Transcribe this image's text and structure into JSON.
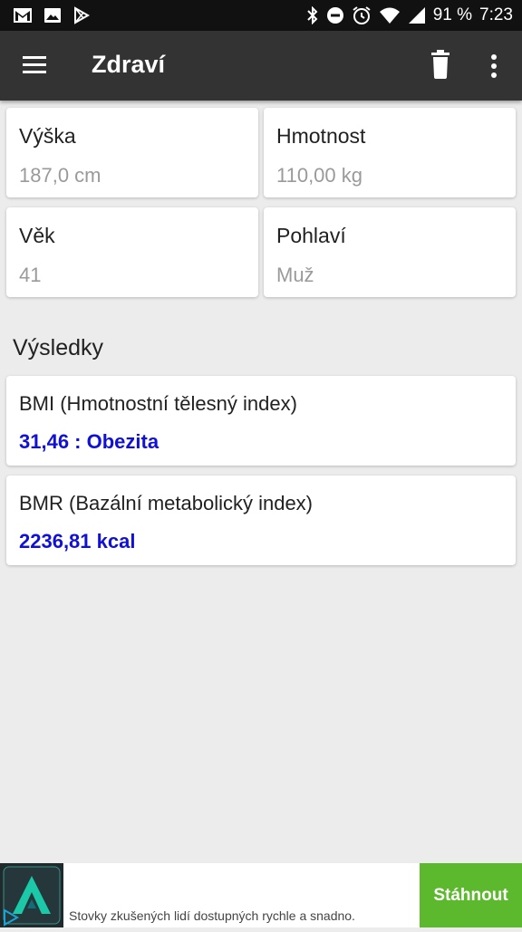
{
  "status_bar": {
    "battery": "91 %",
    "time": "7:23"
  },
  "app_bar": {
    "title": "Zdraví"
  },
  "inputs": [
    {
      "label": "Výška",
      "value": "187,0 cm"
    },
    {
      "label": "Hmotnost",
      "value": "110,00 kg"
    },
    {
      "label": "Věk",
      "value": "41"
    },
    {
      "label": "Pohlaví",
      "value": "Muž"
    }
  ],
  "results": {
    "header": "Výsledky",
    "items": [
      {
        "title": "BMI (Hmotnostní tělesný index)",
        "value": "31,46 : Obezita"
      },
      {
        "title": "BMR (Bazální metabolický index)",
        "value": "2236,81 kcal"
      }
    ]
  },
  "ad": {
    "text": "Stovky zkušených lidí dostupných rychle a snadno.",
    "button_label": "Stáhnout"
  },
  "colors": {
    "app_bar": "#333333",
    "result_value": "#1010d6",
    "ad_button": "#5cb82c"
  }
}
